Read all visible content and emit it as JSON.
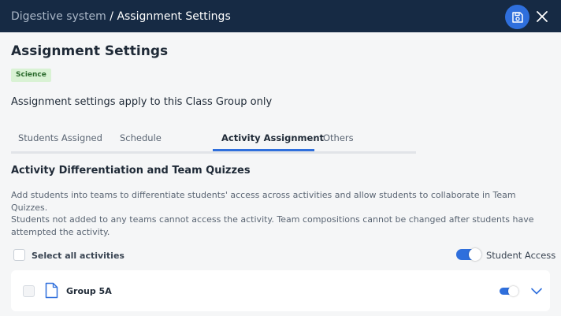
{
  "header": {
    "breadcrumb_parent": "Digestive system",
    "breadcrumb_sep": " / ",
    "breadcrumb_current": "Assignment Settings",
    "save_icon": "save-icon",
    "close_icon": "close-icon"
  },
  "page": {
    "title": "Assignment Settings",
    "subject_badge": "Science",
    "description": "Assignment settings apply to this Class Group only"
  },
  "tabs": [
    {
      "label": "Students Assigned",
      "active": false
    },
    {
      "label": "Schedule",
      "active": false
    },
    {
      "label": "Activity Assignment",
      "active": true
    },
    {
      "label": "Others",
      "active": false
    }
  ],
  "section": {
    "title": "Activity Differentiation and Team Quizzes",
    "para1": "Add students into teams to differentiate students' access across activities and allow students to collaborate in Team Quizzes.",
    "para2": "Students not added to any teams cannot access the activity. Team compositions cannot be changed after students have attempted the activity.",
    "select_all_label": "Select all activities",
    "select_all_checked": false,
    "student_access_label": "Student Access",
    "student_access_on": true
  },
  "groups": [
    {
      "label": "Group 5A",
      "checked": false,
      "access_on": true,
      "icon": "document-icon",
      "expand_icon": "chevron-down-icon"
    }
  ],
  "colors": {
    "topbar": "#162a44",
    "accent": "#2f6fdc",
    "badge_bg": "#d9f2d4",
    "badge_text": "#2a6a2c"
  }
}
